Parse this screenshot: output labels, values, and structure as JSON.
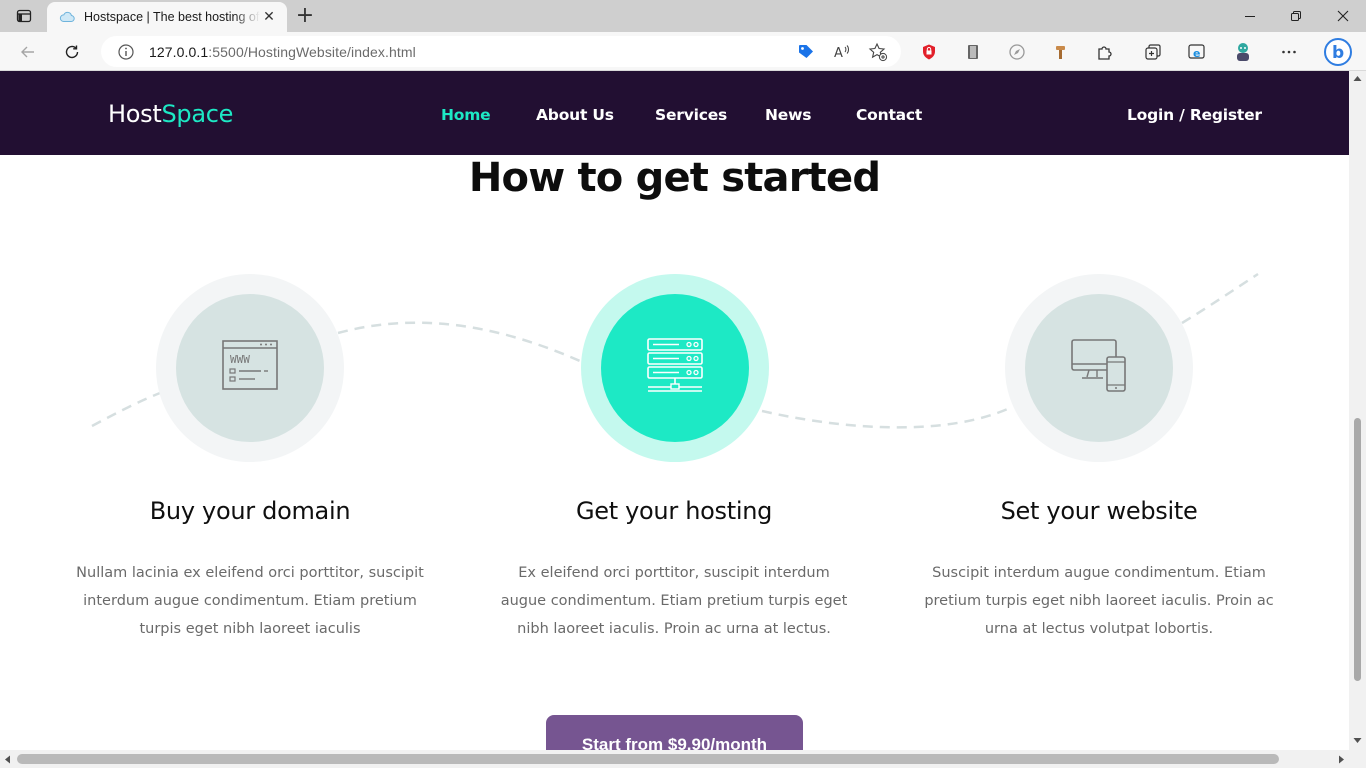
{
  "browser": {
    "tab": {
      "title": "Hostspace | The best hosting offers",
      "favicon": "cloud-icon"
    },
    "url": {
      "host": "127.0.0.1",
      "rest": ":5500/HostingWebsite/index.html"
    }
  },
  "site": {
    "brand": {
      "part1": "Host",
      "part2": "Space"
    },
    "nav": [
      {
        "label": "Home",
        "active": true
      },
      {
        "label": "About Us",
        "active": false
      },
      {
        "label": "Services",
        "active": false
      },
      {
        "label": "News",
        "active": false
      },
      {
        "label": "Contact",
        "active": false
      }
    ],
    "auth_label": "Login / Register",
    "section_title": "How to get started",
    "steps": [
      {
        "icon": "www-browser-icon",
        "title": "Buy your domain",
        "text": "Nullam lacinia ex eleifend orci porttitor, suscipit interdum augue condimentum. Etiam pretium turpis eget nibh laoreet iaculis"
      },
      {
        "icon": "server-icon",
        "title": "Get your hosting",
        "text": "Ex eleifend orci porttitor, suscipit interdum augue condimentum. Etiam pretium turpis eget nibh laoreet iaculis. Proin ac urna at lectus."
      },
      {
        "icon": "devices-icon",
        "title": "Set your website",
        "text": "Suscipit interdum augue condimentum. Etiam pretium turpis eget nibh laoreet iaculis. Proin ac urna at lectus volutpat lobortis."
      }
    ],
    "cta_label": "Start from $9.90/month"
  },
  "colors": {
    "navbar_bg": "#220f32",
    "accent_teal": "#1de9c5",
    "cta_purple": "#765591",
    "circle_grey": "#d6e3e2"
  }
}
